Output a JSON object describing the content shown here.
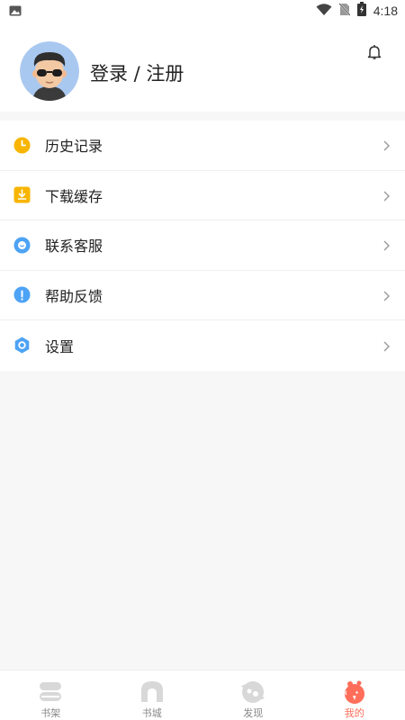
{
  "status_bar": {
    "time": "4:18"
  },
  "header": {
    "login_label": "登录 / 注册"
  },
  "menu": {
    "items": [
      {
        "label": "历史记录",
        "icon": "clock-icon",
        "color": "#f7b500"
      },
      {
        "label": "下载缓存",
        "icon": "download-icon",
        "color": "#f7b500"
      },
      {
        "label": "联系客服",
        "icon": "smile-icon",
        "color": "#4da3f5"
      },
      {
        "label": "帮助反馈",
        "icon": "info-icon",
        "color": "#4da3f5"
      },
      {
        "label": "设置",
        "icon": "settings-icon",
        "color": "#4da3f5"
      }
    ]
  },
  "tabbar": {
    "tabs": [
      {
        "label": "书架",
        "icon": "bookshelf-icon",
        "active": false
      },
      {
        "label": "书城",
        "icon": "bookstore-icon",
        "active": false
      },
      {
        "label": "发现",
        "icon": "discover-icon",
        "active": false
      },
      {
        "label": "我的",
        "icon": "mine-icon",
        "active": true
      }
    ]
  },
  "colors": {
    "accent": "#ff6e5a",
    "inactive_tab": "#d8d8d8"
  }
}
